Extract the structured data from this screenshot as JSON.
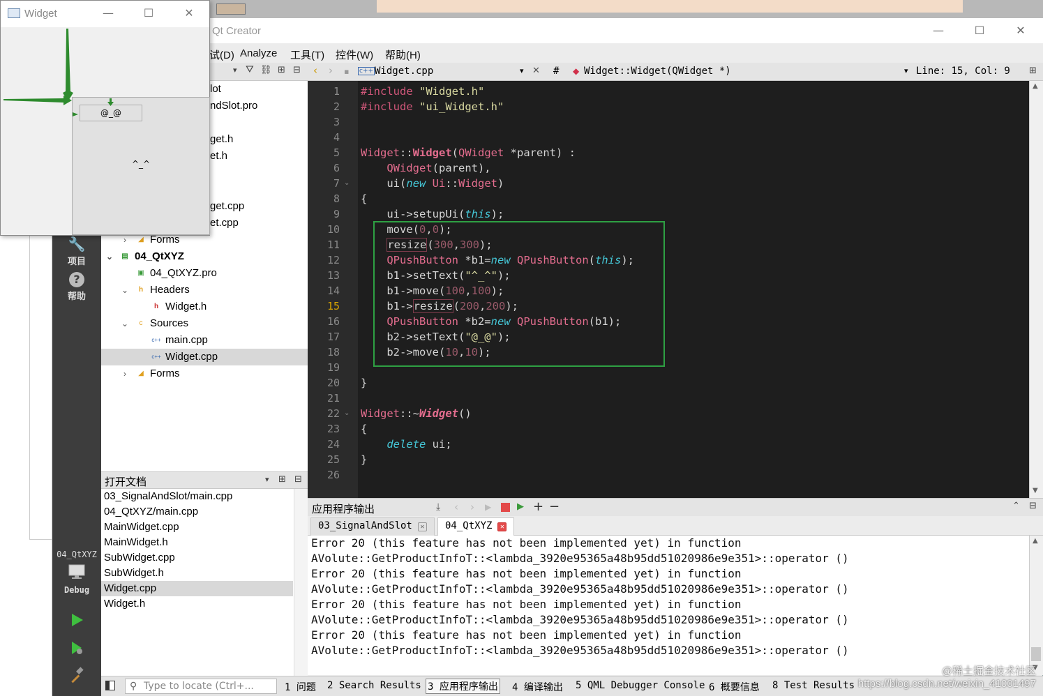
{
  "main_window": {
    "title": "Qt Creator",
    "controls": {
      "minimize": "—",
      "maximize": "☐",
      "close": "✕"
    }
  },
  "menu": [
    "试(D)",
    "Analyze",
    "工具(T)",
    "控件(W)",
    "帮助(H)"
  ],
  "mode_bar": {
    "items": [
      {
        "label": "项目",
        "icon": "wrench-icon"
      },
      {
        "label": "帮助",
        "icon": "help-icon"
      }
    ],
    "kit": {
      "project": "04_QtXYZ",
      "config": "Debug"
    }
  },
  "project_tree": {
    "rows": [
      {
        "label": "lot"
      },
      {
        "label": "ndSlot.pro"
      },
      {
        "label": ""
      },
      {
        "label": "get.h"
      },
      {
        "label": "et.h"
      },
      {
        "label": ""
      },
      {
        "label": ""
      },
      {
        "label": "get.cpp"
      },
      {
        "label": "et.cpp"
      },
      {
        "label": "Forms",
        "arrow": "›",
        "icon": "forms-icon"
      },
      {
        "label": "04_QtXYZ",
        "arrow": "⌄",
        "icon": "project-icon",
        "bold": true
      },
      {
        "label": "04_QtXYZ.pro",
        "icon": "pro-file-icon"
      },
      {
        "label": "Headers",
        "arrow": "⌄",
        "icon": "headers-icon"
      },
      {
        "label": "Widget.h",
        "icon": "header-file-icon"
      },
      {
        "label": "Sources",
        "arrow": "⌄",
        "icon": "sources-icon"
      },
      {
        "label": "main.cpp",
        "icon": "cpp-file-icon"
      },
      {
        "label": "Widget.cpp",
        "icon": "cpp-file-icon",
        "selected": true
      },
      {
        "label": "Forms",
        "arrow": "›",
        "icon": "forms-icon"
      }
    ]
  },
  "open_docs": {
    "title": "打开文档",
    "items": [
      "03_SignalAndSlot/main.cpp",
      "04_QtXYZ/main.cpp",
      "MainWidget.cpp",
      "MainWidget.h",
      "SubWidget.cpp",
      "SubWidget.h",
      "Widget.cpp",
      "Widget.h"
    ],
    "selected_index": 6
  },
  "editor": {
    "file": "Widget.cpp",
    "hash": "#",
    "symbol": "Widget::Widget(QWidget *)",
    "position": "Line: 15, Col: 9",
    "current_line": 15,
    "line_count": 26
  },
  "output": {
    "title": "应用程序输出",
    "tabs": [
      {
        "label": "03_SignalAndSlot",
        "active": false
      },
      {
        "label": "04_QtXYZ",
        "active": true
      }
    ],
    "lines": [
      "Error 20 (this feature has not been implemented yet) in function",
      "AVolute::GetProductInfoT::<lambda_3920e95365a48b95dd51020986e9e351>::operator ()",
      "Error 20 (this feature has not been implemented yet) in function",
      "AVolute::GetProductInfoT::<lambda_3920e95365a48b95dd51020986e9e351>::operator ()",
      "Error 20 (this feature has not been implemented yet) in function",
      "AVolute::GetProductInfoT::<lambda_3920e95365a48b95dd51020986e9e351>::operator ()",
      "Error 20 (this feature has not been implemented yet) in function",
      "AVolute::GetProductInfoT::<lambda_3920e95365a48b95dd51020986e9e351>::operator ()"
    ]
  },
  "status_bar": {
    "locator_placeholder": "Type to locate (Ctrl+...",
    "tabs": [
      "1 问题",
      "2 Search Results",
      "3 应用程序输出",
      "4 编译输出",
      "5 QML Debugger Console",
      "6 概要信息",
      "8 Test Results"
    ],
    "active_index": 2
  },
  "widget_window": {
    "title": "Widget",
    "b1_text": "^_^",
    "b2_text": "@_@"
  },
  "watermark": {
    "line1": "@稀土掘金技术社区",
    "line2": "https://blog.csdn.net/weixin_41001497"
  },
  "colors": {
    "highlight_box": "#2ea043",
    "editor_bg": "#1e1e1e",
    "mode_bar_bg": "#3d3d3d",
    "annotation_arrows": "#2e8b2e"
  }
}
